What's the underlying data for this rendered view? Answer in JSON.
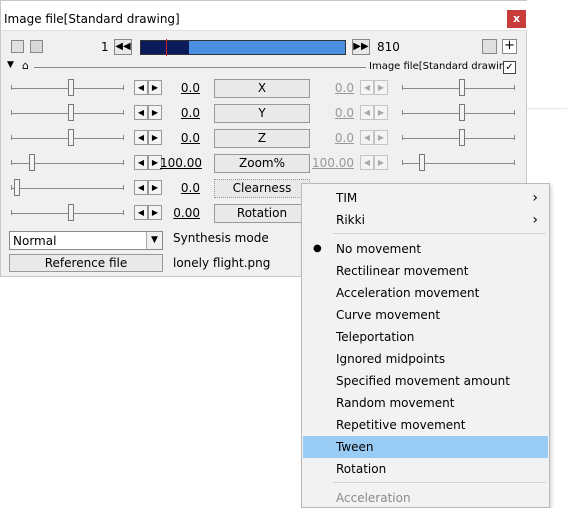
{
  "window": {
    "title": "Image file[Standard drawing]",
    "close_label": "x"
  },
  "toolbar": {
    "start_frame": "1",
    "end_frame": "810",
    "prev_label": "◀◀",
    "next_label": "▶▶",
    "object_name": "Image file[Standard drawing]",
    "checkbox_label": "✓"
  },
  "params": [
    {
      "name": "X",
      "value": "0.0",
      "end_value": "0.0"
    },
    {
      "name": "Y",
      "value": "0.0",
      "end_value": "0.0"
    },
    {
      "name": "Z",
      "value": "0.0",
      "end_value": "0.0"
    },
    {
      "name": "Zoom%",
      "value": "100.00",
      "end_value": "100.00"
    },
    {
      "name": "Clearness",
      "value": "0.0"
    },
    {
      "name": "Rotation",
      "value": "0.00"
    }
  ],
  "blend": {
    "selected": "Normal",
    "label": "Synthesis mode"
  },
  "reference": {
    "button": "Reference file",
    "file": "lonely flight.png"
  },
  "menu": {
    "items": [
      {
        "label": "TIM",
        "submenu": true
      },
      {
        "label": "Rikki",
        "submenu": true
      },
      {
        "label": "No movement",
        "checked": true
      },
      {
        "label": "Rectilinear movement"
      },
      {
        "label": "Acceleration movement"
      },
      {
        "label": "Curve movement"
      },
      {
        "label": "Teleportation"
      },
      {
        "label": "Ignored midpoints"
      },
      {
        "label": "Specified movement amount"
      },
      {
        "label": "Random movement"
      },
      {
        "label": "Repetitive movement"
      },
      {
        "label": "Tween",
        "highlighted": true
      },
      {
        "label": "Rotation"
      },
      {
        "label": "Acceleration",
        "disabled": true
      }
    ]
  }
}
